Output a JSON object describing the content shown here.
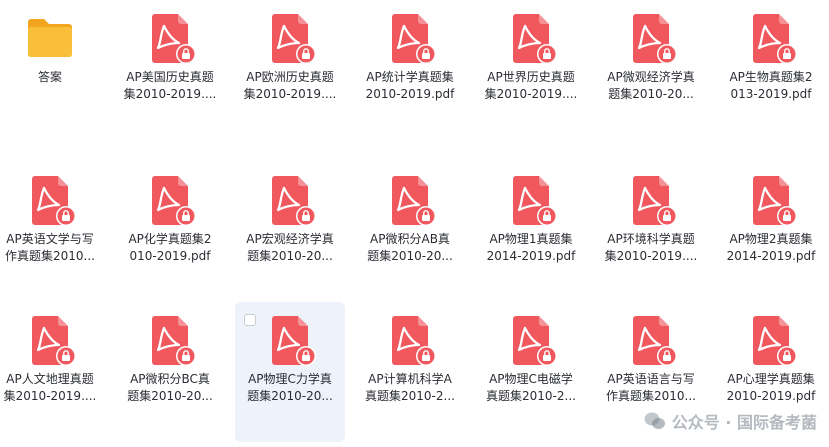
{
  "files": [
    {
      "type": "folder",
      "line1": "答案",
      "line2": ""
    },
    {
      "type": "pdf",
      "line1": "AP美国历史真题",
      "line2": "集2010-2019...."
    },
    {
      "type": "pdf",
      "line1": "AP欧洲历史真题",
      "line2": "集2010-2019...."
    },
    {
      "type": "pdf",
      "line1": "AP统计学真题集",
      "line2": "2010-2019.pdf"
    },
    {
      "type": "pdf",
      "line1": "AP世界历史真题",
      "line2": "集2010-2019...."
    },
    {
      "type": "pdf",
      "line1": "AP微观经济学真",
      "line2": "题集2010-20..."
    },
    {
      "type": "pdf",
      "line1": "AP生物真题集2",
      "line2": "013-2019.pdf"
    },
    {
      "type": "pdf",
      "line1": "AP英语文学与写",
      "line2": "作真题集2010..."
    },
    {
      "type": "pdf",
      "line1": "AP化学真题集2",
      "line2": "010-2019.pdf"
    },
    {
      "type": "pdf",
      "line1": "AP宏观经济学真",
      "line2": "题集2010-20..."
    },
    {
      "type": "pdf",
      "line1": "AP微积分AB真",
      "line2": "题集2010-20..."
    },
    {
      "type": "pdf",
      "line1": "AP物理1真题集",
      "line2": "2014-2019.pdf"
    },
    {
      "type": "pdf",
      "line1": "AP环境科学真题",
      "line2": "集2010-2019...."
    },
    {
      "type": "pdf",
      "line1": "AP物理2真题集",
      "line2": "2014-2019.pdf"
    },
    {
      "type": "pdf",
      "line1": "AP人文地理真题",
      "line2": "集2010-2019...."
    },
    {
      "type": "pdf",
      "line1": "AP微积分BC真",
      "line2": "题集2010-20..."
    },
    {
      "type": "pdf",
      "line1": "AP物理C力学真",
      "line2": "题集2010-20...",
      "selected": true
    },
    {
      "type": "pdf",
      "line1": "AP计算机科学A",
      "line2": "真题集2010-2..."
    },
    {
      "type": "pdf",
      "line1": "AP物理C电磁学",
      "line2": "真题集2010-2..."
    },
    {
      "type": "pdf",
      "line1": "AP英语语言与写",
      "line2": "作真题集2010..."
    },
    {
      "type": "pdf",
      "line1": "AP心理学真题集",
      "line2": "2010-2019.pdf"
    }
  ],
  "watermark": "公众号 · 国际备考菌",
  "colors": {
    "pdf": "#f0585e",
    "folder": "#f9bf3b",
    "folder_back": "#f2a51e"
  }
}
